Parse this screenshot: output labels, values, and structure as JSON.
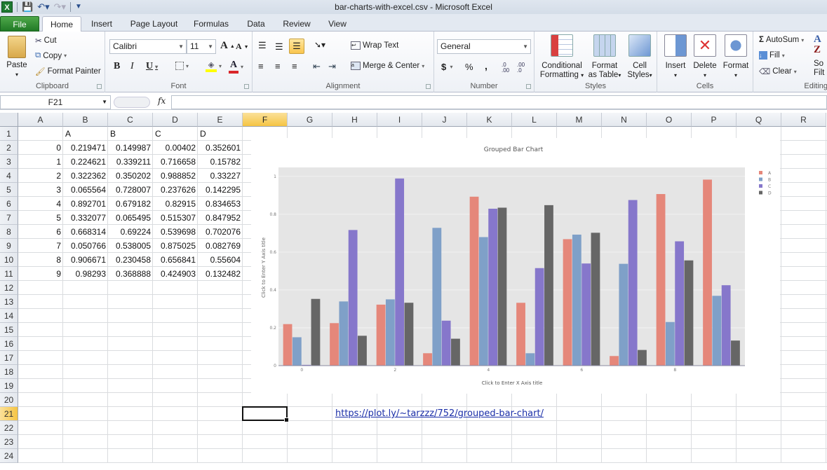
{
  "window": {
    "title": "bar-charts-with-excel.csv  -  Microsoft Excel",
    "app_icon": "excel-icon",
    "quick_access": [
      "save-icon",
      "undo-icon",
      "redo-icon",
      "customize-icon"
    ]
  },
  "tabs": [
    {
      "label": "File"
    },
    {
      "label": "Home",
      "active": true
    },
    {
      "label": "Insert"
    },
    {
      "label": "Page Layout"
    },
    {
      "label": "Formulas"
    },
    {
      "label": "Data"
    },
    {
      "label": "Review"
    },
    {
      "label": "View"
    }
  ],
  "ribbon": {
    "clipboard": {
      "label": "Clipboard",
      "paste": "Paste",
      "cut": "Cut",
      "copy": "Copy",
      "format_painter": "Format Painter"
    },
    "font": {
      "label": "Font",
      "font_name": "Calibri",
      "font_size": "11",
      "bold": "B",
      "italic": "I",
      "underline": "U",
      "grow": "A",
      "shrink": "A",
      "font_color": "#d9262a",
      "fill_color": "#ffff00"
    },
    "alignment": {
      "label": "Alignment",
      "wrap_text": "Wrap Text",
      "merge_center": "Merge & Center"
    },
    "number": {
      "label": "Number",
      "format": "General",
      "currency": "$",
      "percent": "%",
      "comma": ",",
      "inc_decimal": ".0 .00",
      "dec_decimal": ".00 .0"
    },
    "styles": {
      "label": "Styles",
      "conditional": [
        "Conditional",
        "Formatting"
      ],
      "format_table": [
        "Format",
        "as Table"
      ],
      "cell_styles": [
        "Cell",
        "Styles"
      ]
    },
    "cells": {
      "label": "Cells",
      "insert": "Insert",
      "delete": "Delete",
      "format": "Format"
    },
    "editing": {
      "label": "Editing",
      "autosum": "AutoSum",
      "fill": "Fill",
      "clear": "Clear",
      "sort": [
        "So",
        "Filt"
      ]
    }
  },
  "formula_bar": {
    "name_box": "F21",
    "fx": "fx",
    "formula": ""
  },
  "sheet": {
    "columns": [
      "A",
      "B",
      "C",
      "D",
      "E",
      "F",
      "G",
      "H",
      "I",
      "J",
      "K",
      "L",
      "M",
      "N",
      "O",
      "P",
      "Q",
      "R"
    ],
    "rows": [
      "1",
      "2",
      "3",
      "4",
      "5",
      "6",
      "7",
      "8",
      "9",
      "10",
      "11",
      "12",
      "13",
      "14",
      "15",
      "16",
      "17",
      "18",
      "19",
      "20",
      "21",
      "22",
      "23",
      "24"
    ],
    "selected_cell": "F21",
    "header_row": [
      "",
      "A",
      "B",
      "C",
      "D"
    ],
    "data_rows": [
      [
        "0",
        "0.219471",
        "0.149987",
        "0.00402",
        "0.352601"
      ],
      [
        "1",
        "0.224621",
        "0.339211",
        "0.716658",
        "0.15782"
      ],
      [
        "2",
        "0.322362",
        "0.350202",
        "0.988852",
        "0.33227"
      ],
      [
        "3",
        "0.065564",
        "0.728007",
        "0.237626",
        "0.142295"
      ],
      [
        "4",
        "0.892701",
        "0.679182",
        "0.82915",
        "0.834653"
      ],
      [
        "5",
        "0.332077",
        "0.065495",
        "0.515307",
        "0.847952"
      ],
      [
        "6",
        "0.668314",
        "0.69224",
        "0.539698",
        "0.702076"
      ],
      [
        "7",
        "0.050766",
        "0.538005",
        "0.875025",
        "0.082769"
      ],
      [
        "8",
        "0.906671",
        "0.230458",
        "0.656841",
        "0.55604"
      ],
      [
        "9",
        "0.98293",
        "0.368888",
        "0.424903",
        "0.132482"
      ]
    ],
    "hyperlink": "https://plot.ly/~tarzzz/752/grouped-bar-chart/"
  },
  "chart_data": {
    "type": "bar",
    "title": "Grouped Bar Chart",
    "xlabel": "Click to Enter X Axis title",
    "ylabel": "Click to Enter Y Axis title",
    "x": [
      0,
      1,
      2,
      3,
      4,
      5,
      6,
      7,
      8,
      9
    ],
    "x_ticks": [
      "0",
      "2",
      "4",
      "6",
      "8"
    ],
    "y_ticks": [
      "0",
      "0.2",
      "0.4",
      "0.6",
      "0.8",
      "1"
    ],
    "ylim": [
      0,
      1.04
    ],
    "grid": true,
    "legend": "top-right",
    "series": [
      {
        "name": "A",
        "color": "#e5877a",
        "values": [
          0.219471,
          0.224621,
          0.322362,
          0.065564,
          0.892701,
          0.332077,
          0.668314,
          0.050766,
          0.906671,
          0.98293
        ]
      },
      {
        "name": "B",
        "color": "#7fa0c8",
        "values": [
          0.149987,
          0.339211,
          0.350202,
          0.728007,
          0.679182,
          0.065495,
          0.69224,
          0.538005,
          0.230458,
          0.368888
        ]
      },
      {
        "name": "C",
        "color": "#8677cb",
        "values": [
          0.00402,
          0.716658,
          0.988852,
          0.237626,
          0.82915,
          0.515307,
          0.539698,
          0.875025,
          0.656841,
          0.424903
        ]
      },
      {
        "name": "D",
        "color": "#666666",
        "values": [
          0.352601,
          0.15782,
          0.33227,
          0.142295,
          0.834653,
          0.847952,
          0.702076,
          0.082769,
          0.55604,
          0.132482
        ]
      }
    ]
  }
}
